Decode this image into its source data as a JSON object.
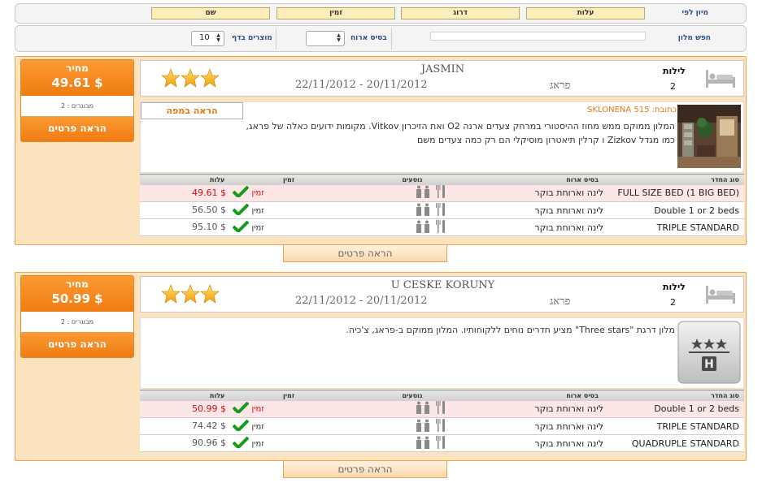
{
  "sort_bar": {
    "label": "מיון לפי",
    "buttons": [
      "עלות",
      "דרוג",
      "זמין",
      "שם"
    ]
  },
  "search_bar": {
    "label": "חפש מלון",
    "board_label": "בסיס ארוח",
    "per_page_label": "מוצרים בדף",
    "per_page_value": "10",
    "board_value": ""
  },
  "table_headers": {
    "room_type": "סוג החדר",
    "board": "בסיס ארוח",
    "passengers": "נוסעים",
    "availability": "זמין",
    "cost": "עלות"
  },
  "common": {
    "price_label": "מחיר",
    "show_details": "הראה פרטים",
    "nights_label": "לילות",
    "show_on_map": "הראה במפה"
  },
  "hotels": [
    {
      "name": "JASMIN",
      "dates": "22/11/2012 - 20/11/2012",
      "city": "פראג",
      "nights": "2",
      "stars": 3,
      "price": "49.61 $",
      "adults": "מבוגרים : 2",
      "address_label": "כתובת:",
      "address": "SKLONENA 515",
      "description": [
        "המלון ממוקם ממש מחוז ההיסטורי במרחק צעדים ארנה O2 ואת הזיכרון Vitkov. מקומות ידועים כאלה של פראג,",
        "כמו מגדל Zizkov ו קרלין תיאטרון מוסיקלי הם רק כמה צעדים משם"
      ],
      "rooms": [
        {
          "type": "FULL SIZE BED (1 BIG BED)",
          "board": "לינה וארוחת בוקר",
          "avail": "זמין",
          "price": "49.61 $",
          "highlight": true
        },
        {
          "type": "Double 1 or 2 beds",
          "board": "לינה וארוחת בוקר",
          "avail": "זמין",
          "price": "56.50 $",
          "highlight": false
        },
        {
          "type": "TRIPLE STANDARD",
          "board": "לינה וארוחת בוקר",
          "avail": "זמין",
          "price": "95.10 $",
          "highlight": false
        }
      ]
    },
    {
      "name": "U CESKE KORUNY",
      "dates": "22/11/2012 - 20/11/2012",
      "city": "פראג",
      "nights": "2",
      "stars": 3,
      "price": "50.99 $",
      "adults": "מבוגרים : 2",
      "description": [
        "מלון דרגת \"Three stars\" מציע חדרים נוחים ללקוחותיו. המלון ממוקם ב-פראג, צ'כיה."
      ],
      "rooms": [
        {
          "type": "Double 1 or 2 beds",
          "board": "לינה וארוחת בוקר",
          "avail": "זמין",
          "price": "50.99 $",
          "highlight": true
        },
        {
          "type": "TRIPLE STANDARD",
          "board": "לינה וארוחת בוקר",
          "avail": "זמין",
          "price": "74.42 $",
          "highlight": false
        },
        {
          "type": "QUADRUPLE STANDARD",
          "board": "לינה וארוחת בוקר",
          "avail": "זמין",
          "price": "90.96 $",
          "highlight": false
        }
      ]
    }
  ],
  "colors": {
    "accent_orange": "#f07c11",
    "sort_button_bg": "#fbeeb9",
    "label_blue": "#2c4f8c",
    "price_red": "#d20d0d",
    "tick_green": "#1a9a1a"
  },
  "icons": {
    "bed": "bed-icon",
    "stars": "star-icon",
    "fork_knife": "fork-knife-icon",
    "person": "person-icon",
    "check": "check-icon",
    "hotel_placeholder": "hotel-placeholder-icon"
  }
}
